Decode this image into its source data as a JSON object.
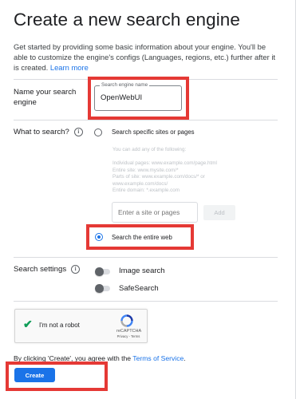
{
  "header": {
    "title": "Create a new search engine",
    "intro": "Get started by providing some basic information about your engine. You'll be able to customize the engine's configs (Languages, regions, etc.) further after it is created.",
    "learn_more": "Learn more"
  },
  "name_section": {
    "label": "Name your search engine",
    "field_label": "Search engine name",
    "field_value": "OpenWebUI"
  },
  "what_section": {
    "label": "What to search?",
    "info_icon": "info-icon",
    "option_specific": "Search specific sites or pages",
    "hint_title": "You can add any of the following:",
    "hint_lines": [
      "Individual pages: www.example.com/page.html",
      "Entire site: www.mysite.com/*",
      "Parts of site: www.example.com/docs/* or",
      "www.example.com/docs/",
      "Entire domain: *.example.com"
    ],
    "site_placeholder": "Enter a site or pages",
    "add_label": "Add",
    "option_entire": "Search the entire web",
    "selected": "entire"
  },
  "settings_section": {
    "label": "Search settings",
    "image_search": "Image search",
    "safesearch": "SafeSearch",
    "image_search_on": false,
    "safesearch_on": false
  },
  "captcha": {
    "text": "I'm not a robot",
    "brand": "reCAPTCHA",
    "privacy": "Privacy",
    "terms": "Terms"
  },
  "footer": {
    "terms_prefix": "By clicking 'Create', you agree with the",
    "terms_link": "Terms of Service",
    "terms_suffix": ".",
    "create_label": "Create"
  },
  "colors": {
    "accent": "#1a73e8",
    "highlight": "#e53935"
  }
}
